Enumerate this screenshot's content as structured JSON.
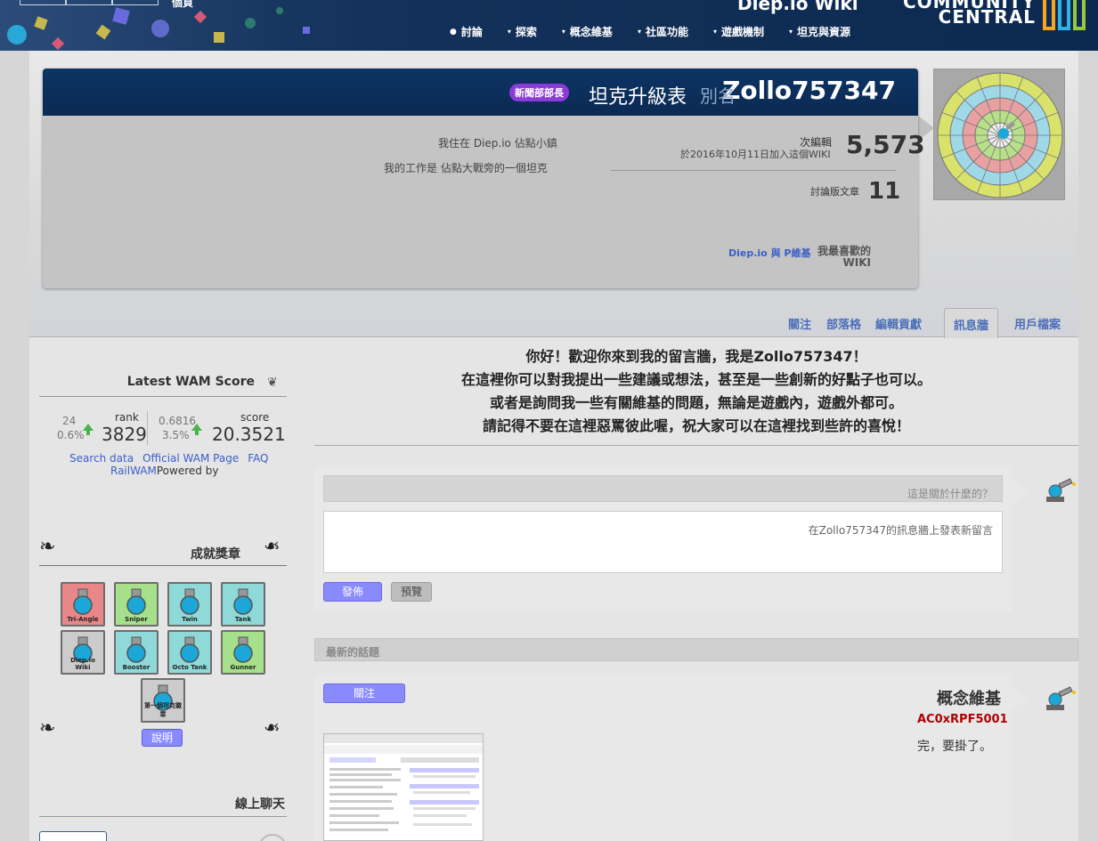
{
  "top": {
    "wiki_name": "Diep.io Wiki",
    "left_label": "個頁",
    "logo_line1": "COMMUNITY",
    "logo_line2": "CENTRAL",
    "nav": [
      {
        "label": "坦克與資源",
        "caret": "▾"
      },
      {
        "label": "遊戲機制",
        "caret": "▾"
      },
      {
        "label": "社區功能",
        "caret": "▾"
      },
      {
        "label": "概念維基",
        "caret": "▾"
      },
      {
        "label": "探索",
        "caret": "▾"
      },
      {
        "label": "討論",
        "caret": ""
      }
    ]
  },
  "profile": {
    "username": "Zollo757347",
    "aka": "別名",
    "title": "坦克升級表",
    "group_badge": "新聞部部長",
    "edits": "5,573",
    "edits_label": "次編輯",
    "joined": "於2016年10月11日加入這個WIKI",
    "discussions": "11",
    "discussions_label": "討論版文章",
    "location": "我住在 Diep.io 佔點小鎮",
    "job": "我的工作是 佔點大戰旁的一個坦克",
    "fav_label": "我最喜歡的\nWIKI",
    "fav_wiki": "Diep.io 與 P維基"
  },
  "tabs": [
    "用戶檔案",
    "訊息牆",
    "編輯貢獻",
    "部落格",
    "關注"
  ],
  "active_tab": 1,
  "welcome": [
    "你好！歡迎你來到我的留言牆，我是Zollo757347！",
    "在這裡你可以對我提出一些建議或想法，甚至是一些創新的好點子也可以。",
    "或者是詢問我一些有關維基的問題，無論是遊戲內，遊戲外都可。",
    "請記得不要在這裡惡罵彼此喔，祝大家可以在這裡找到些許的喜悅！"
  ],
  "new_post": {
    "title_placeholder": "這是關於什麼的？",
    "body_placeholder": "在Zollo757347的訊息牆上發表新留言",
    "publish": "發佈",
    "preview": "預覽"
  },
  "recent_label": "最新的話題",
  "thread": {
    "title": "概念維基",
    "author": "AC0xRPF5001",
    "text": "完，要掛了。",
    "follow": "關注"
  },
  "wam": {
    "heading": "Latest WAM Score",
    "score_label": "score",
    "score": "20.3521",
    "score_delta1": "0.6816",
    "score_delta2": "3.5%",
    "rank_label": "rank",
    "rank": "3829",
    "rank_delta1": "24",
    "rank_delta2": "0.6%",
    "links": [
      "FAQ",
      "Official WAM Page",
      "Search data"
    ],
    "powered_prefix": "Powered by ",
    "powered_link": "RailWAM"
  },
  "badges": {
    "heading": "成就獎章",
    "items": [
      {
        "label": "Tank",
        "color": "#8fd9d9"
      },
      {
        "label": "Twin",
        "color": "#8fd9d9"
      },
      {
        "label": "Sniper",
        "color": "#a7e08a"
      },
      {
        "label": "Tri-Angle",
        "color": "#e88787"
      },
      {
        "label": "Gunner",
        "color": "#a7e08a"
      },
      {
        "label": "Octo Tank",
        "color": "#8fd9d9"
      },
      {
        "label": "Booster",
        "color": "#8fd9d9"
      },
      {
        "label": "Diep.io Wiki",
        "color": "#cccccc"
      },
      {
        "label": "第一個坦克徽章",
        "color": "#cccccc"
      }
    ],
    "help": "說明"
  },
  "chat": {
    "heading": "線上聊天"
  }
}
